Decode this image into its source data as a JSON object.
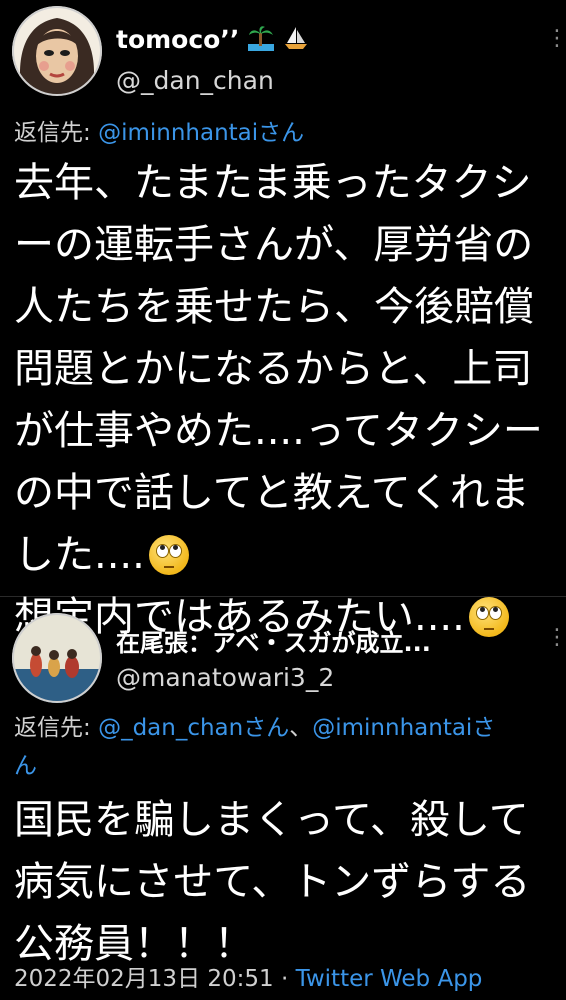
{
  "tweet1": {
    "display_name": "tomocoʼʼ",
    "name_icons": [
      "palm-tree-icon",
      "sailboat-icon"
    ],
    "handle": "@_dan_chan",
    "more_icon": "more-vertical-icon",
    "reply_label": "返信先:",
    "reply_to": "@iminnhantaiさん",
    "body_lines": [
      "去年、たまたま乗ったタクシ",
      "ーの運転手さんが、厚労省の",
      "人たちを乗せたら、今後賠償",
      "問題とかになるからと、上司",
      "が仕事やめた....ってタクシー",
      "の中で話してと教えてくれま",
      "した....",
      "想定内ではあるみたい...."
    ],
    "emoji": "face-with-rolling-eyes"
  },
  "tweet2": {
    "display_name": "在尾張：アベ・スガが成立...",
    "handle": "@manatowari3_2",
    "more_icon": "more-vertical-icon",
    "reply_label": "返信先:",
    "reply_to_1": "@_dan_chanさん",
    "reply_sep": "、",
    "reply_to_2": "@iminnhantaiさ",
    "reply_to_2_cont": "ん",
    "body_lines": [
      "国民を騙しまくって、殺して",
      "病気にさせて、トンずらする",
      "公務員！！！"
    ],
    "timestamp": "2022年02月13日 20:51",
    "sep": " · ",
    "app": "Twitter Web App"
  },
  "colors": {
    "background": "#000000",
    "link": "#3b95e8",
    "secondary_text": "#d0d0d0"
  }
}
